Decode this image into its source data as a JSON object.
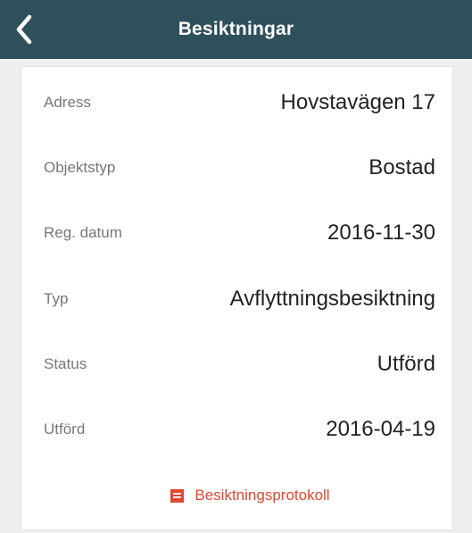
{
  "header": {
    "title": "Besiktningar",
    "back_icon": "chevron-left-icon"
  },
  "details": {
    "address_label": "Adress",
    "address_value": "Hovstavägen 17",
    "object_type_label": "Objektstyp",
    "object_type_value": "Bostad",
    "reg_date_label": "Reg. datum",
    "reg_date_value": "2016-11-30",
    "type_label": "Typ",
    "type_value": "Avflyttningsbesiktning",
    "status_label": "Status",
    "status_value": "Utförd",
    "performed_label": "Utförd",
    "performed_value": "2016-04-19"
  },
  "document": {
    "label": "Besiktningsprotokoll",
    "icon": "document-icon"
  },
  "colors": {
    "header_bg": "#2f4f5c",
    "accent": "#e2462e"
  }
}
